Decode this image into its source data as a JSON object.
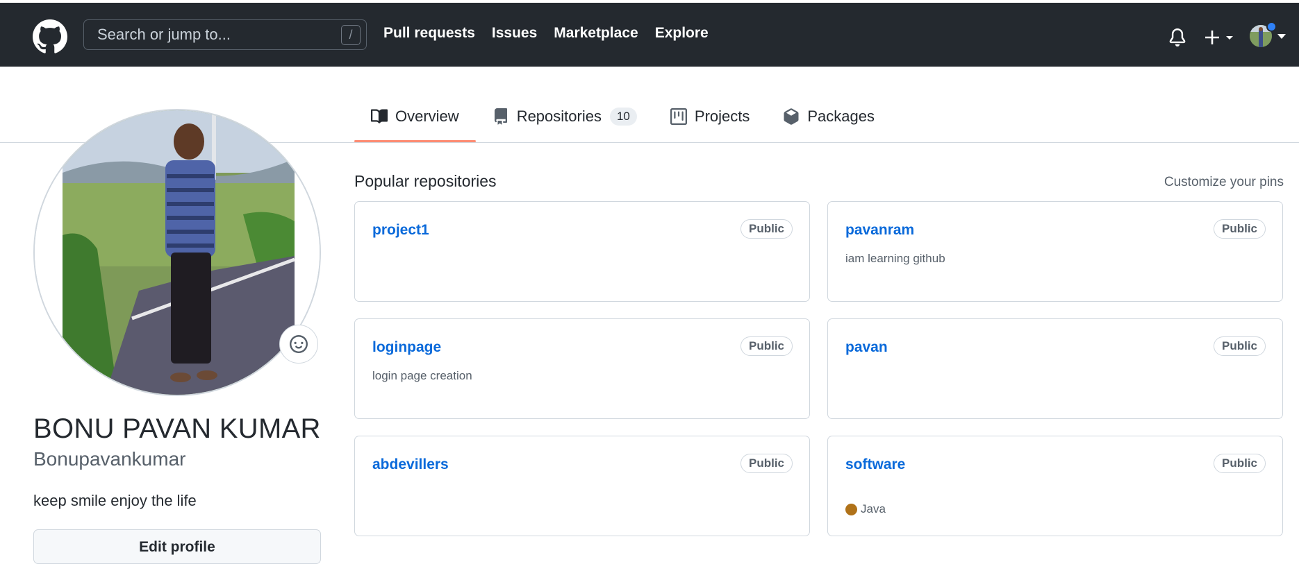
{
  "header": {
    "search_placeholder": "Search or jump to...",
    "search_shortcut": "/",
    "nav": [
      "Pull requests",
      "Issues",
      "Marketplace",
      "Explore"
    ]
  },
  "tabs": [
    {
      "label": "Overview",
      "active": true
    },
    {
      "label": "Repositories",
      "count": "10"
    },
    {
      "label": "Projects"
    },
    {
      "label": "Packages"
    }
  ],
  "profile": {
    "full_name": "BONU PAVAN KUMAR",
    "username": "Bonupavankumar",
    "bio": "keep smile enjoy the life",
    "edit_label": "Edit profile"
  },
  "popular": {
    "title": "Popular repositories",
    "customize": "Customize your pins",
    "repos": [
      {
        "name": "project1",
        "visibility": "Public",
        "description": "",
        "language": ""
      },
      {
        "name": "pavanram",
        "visibility": "Public",
        "description": "iam learning github",
        "language": ""
      },
      {
        "name": "loginpage",
        "visibility": "Public",
        "description": "login page creation",
        "language": ""
      },
      {
        "name": "pavan",
        "visibility": "Public",
        "description": "",
        "language": ""
      },
      {
        "name": "abdevillers",
        "visibility": "Public",
        "description": "",
        "language": ""
      },
      {
        "name": "software",
        "visibility": "Public",
        "description": "",
        "language": "Java",
        "language_color": "#b07219"
      }
    ]
  },
  "colors": {
    "header_bg": "#24292f",
    "link": "#0969da",
    "tab_underline": "#fd8c73"
  }
}
